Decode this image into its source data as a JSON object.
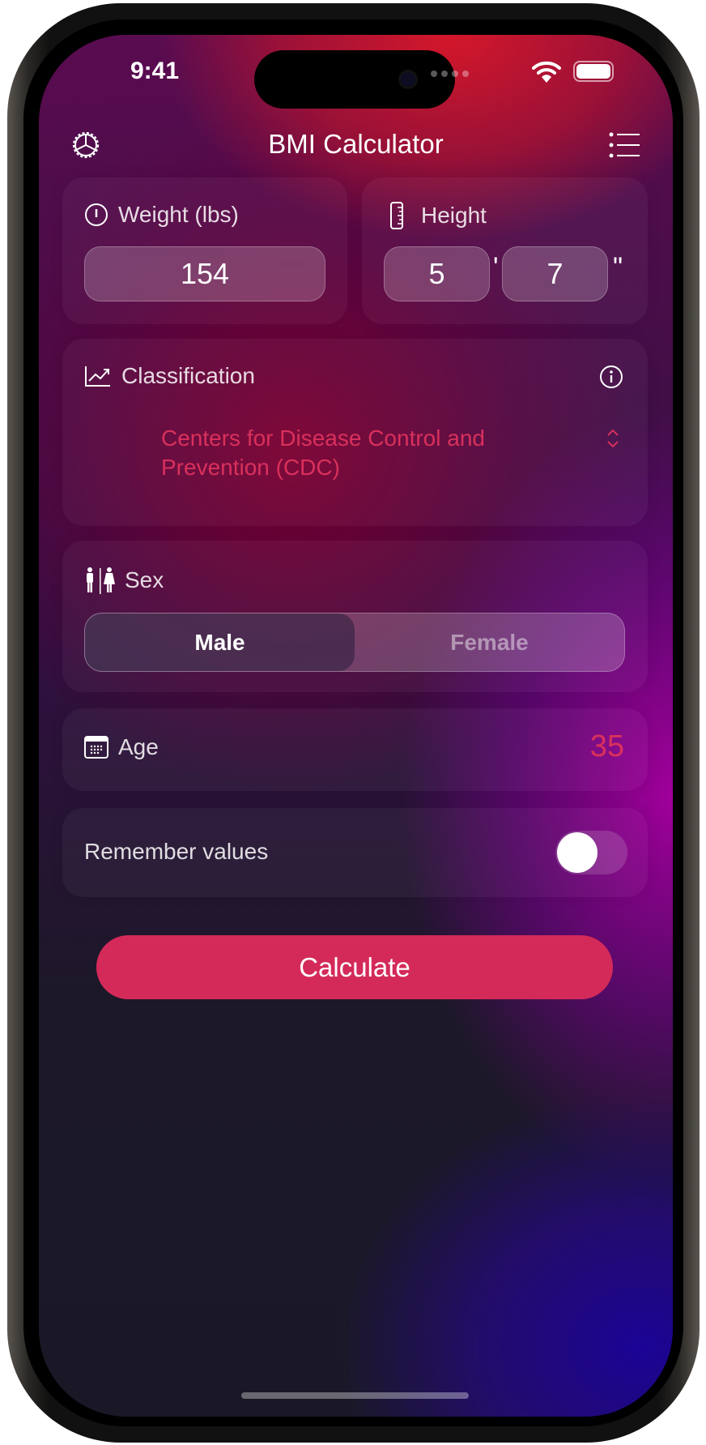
{
  "status": {
    "time": "9:41"
  },
  "nav": {
    "title": "BMI Calculator",
    "settings_icon": "gear-icon",
    "menu_icon": "list-icon"
  },
  "weight": {
    "label": "Weight (lbs)",
    "value": "154"
  },
  "height": {
    "label": "Height",
    "feet": "5",
    "inches": "7",
    "feet_unit": "'",
    "inch_unit": "\""
  },
  "classification": {
    "label": "Classification",
    "value_line1": "Centers for Disease Control and",
    "value_line2": "Prevention (CDC)"
  },
  "sex": {
    "label": "Sex",
    "options": [
      "Male",
      "Female"
    ],
    "selected": "Male"
  },
  "age": {
    "label": "Age",
    "value": "35"
  },
  "remember": {
    "label": "Remember values",
    "on": false
  },
  "calculate": {
    "label": "Calculate"
  },
  "colors": {
    "accent": "#d42a5a",
    "value_text": "#d9305c"
  }
}
